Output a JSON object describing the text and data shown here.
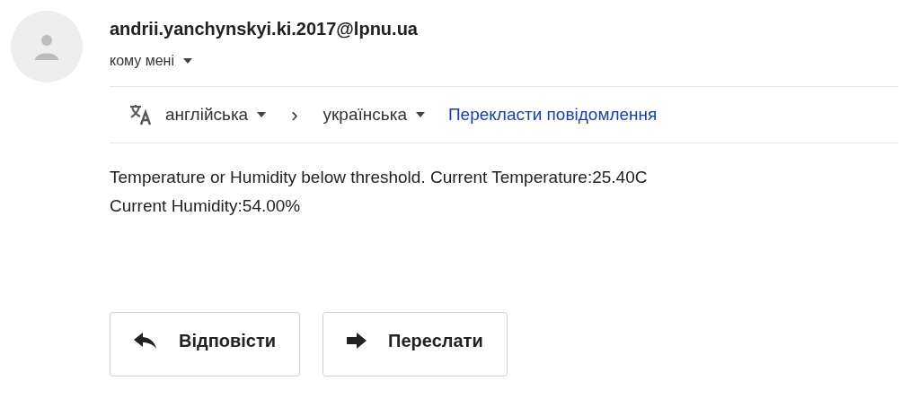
{
  "sender": {
    "email": "andrii.yanchynskyi.ki.2017@lpnu.ua",
    "recipient": "кому мені"
  },
  "translate": {
    "source_language": "англійська",
    "arrow": "›",
    "target_language": "українська",
    "link": "Перекласти повідомлення"
  },
  "body": [
    "Temperature or Humidity below threshold. Current Temperature:25.40C",
    "Current Humidity:54.00%"
  ],
  "actions": [
    {
      "kind": "reply",
      "label": "Відповісти"
    },
    {
      "kind": "forward",
      "label": "Переслати"
    }
  ]
}
